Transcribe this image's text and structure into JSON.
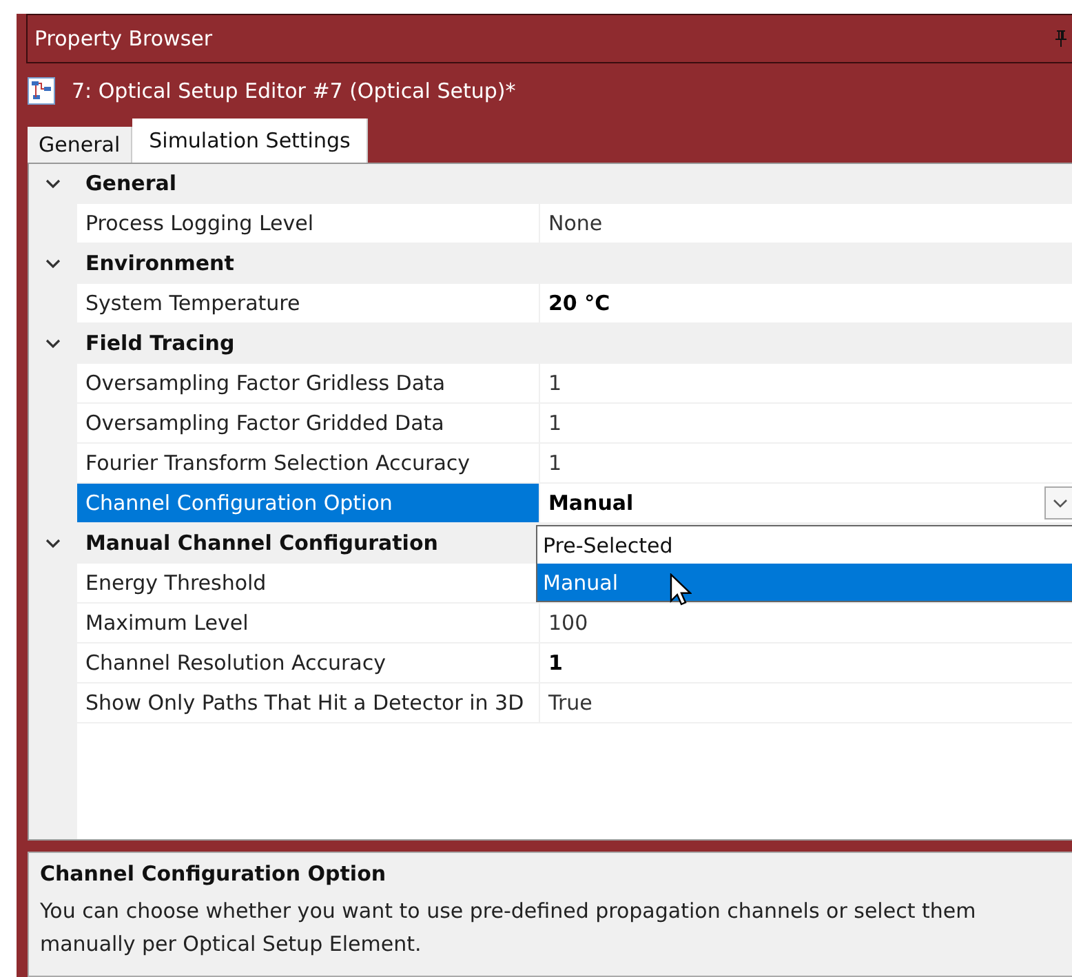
{
  "panel": {
    "title": "Property Browser"
  },
  "editor": {
    "title": "7: Optical Setup Editor #7 (Optical Setup)*"
  },
  "tabs": [
    {
      "label": "General",
      "selected": false
    },
    {
      "label": "Simulation Settings",
      "selected": true
    }
  ],
  "categories": [
    {
      "name": "General",
      "expanded": true,
      "properties": [
        {
          "name": "Process Logging Level",
          "value": "None",
          "modified": false,
          "selected": false
        }
      ]
    },
    {
      "name": "Environment",
      "expanded": true,
      "properties": [
        {
          "name": "System Temperature",
          "value": "20 °C",
          "modified": true,
          "selected": false
        }
      ]
    },
    {
      "name": "Field Tracing",
      "expanded": true,
      "properties": [
        {
          "name": "Oversampling Factor Gridless Data",
          "value": "1",
          "modified": false,
          "selected": false
        },
        {
          "name": "Oversampling Factor Gridded Data",
          "value": "1",
          "modified": false,
          "selected": false
        },
        {
          "name": "Fourier Transform Selection Accuracy",
          "value": "1",
          "modified": false,
          "selected": false
        },
        {
          "name": "Channel Configuration Option",
          "value": "Manual",
          "modified": true,
          "selected": true,
          "dropdown": {
            "options": [
              {
                "label": "Pre-Selected",
                "selected": false
              },
              {
                "label": "Manual",
                "selected": true
              }
            ]
          }
        }
      ]
    },
    {
      "name": "Manual Channel Configuration",
      "expanded": true,
      "properties": [
        {
          "name": "Energy Threshold",
          "selected": false
        },
        {
          "name": "Maximum Level",
          "value": "100",
          "modified": false,
          "selected": false
        },
        {
          "name": "Channel Resolution Accuracy",
          "value": "1",
          "modified": true,
          "selected": false
        },
        {
          "name": "Show Only Paths That Hit a Detector in 3D",
          "value": "True",
          "modified": false,
          "selected": false
        }
      ]
    }
  ],
  "help": {
    "title": "Channel Configuration Option",
    "text": "You can choose whether you want to use pre-defined propagation channels or select them manually per Optical Setup Element."
  }
}
